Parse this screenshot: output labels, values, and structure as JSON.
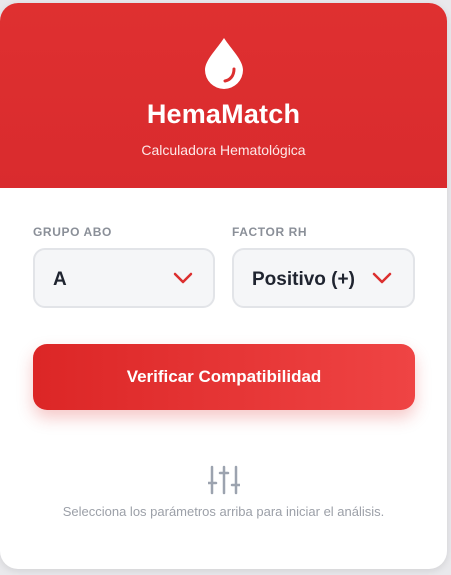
{
  "app": {
    "name": "HemaMatch",
    "subtitle": "Calculadora Hematológica"
  },
  "form": {
    "abo_label": "GRUPO ABO",
    "abo_value": "A",
    "rh_label": "FACTOR RH",
    "rh_value": "Positivo (+)"
  },
  "actions": {
    "verify_label": "Verificar Compatibilidad"
  },
  "empty_state": {
    "icon": "sliders-icon",
    "message": "Selecciona los parámetros arriba para iniciar el análisis."
  },
  "colors": {
    "brand": "#dc2f2f",
    "accent": "#ef4444"
  }
}
